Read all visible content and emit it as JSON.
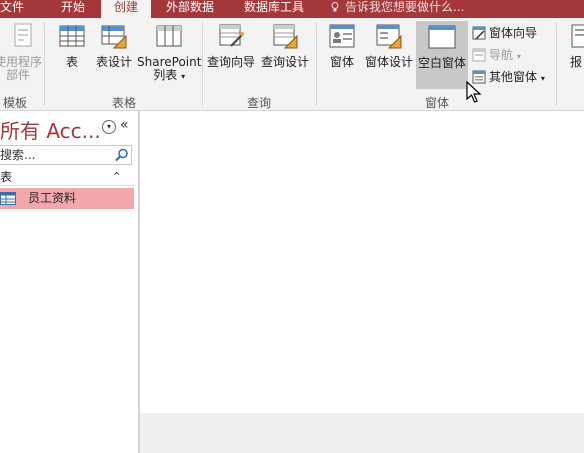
{
  "tabs": {
    "file": "文件",
    "home": "开始",
    "create": "创建",
    "external": "外部数据",
    "dbtools": "数据库工具",
    "tell_me": "告诉我您想要做什么..."
  },
  "ribbon": {
    "templates": {
      "app_parts_line1": "使用程序",
      "app_parts_line2": "部件",
      "label": "模板"
    },
    "tables": {
      "table": "表",
      "table_design": "表设计",
      "sharepoint_line1": "SharePoint",
      "sharepoint_line2": "列表",
      "label": "表格"
    },
    "queries": {
      "query_wizard": "查询向导",
      "query_design": "查询设计",
      "label": "查询"
    },
    "forms": {
      "form": "窗体",
      "form_design": "窗体设计",
      "blank_form": "空白窗体",
      "form_wizard": "窗体向导",
      "navigation": "导航",
      "more_forms": "其他窗体",
      "label": "窗体"
    },
    "reports": {
      "report": "报"
    }
  },
  "nav": {
    "title": "所有 Acc...",
    "search_placeholder": "搜索...",
    "section": "表",
    "items": [
      {
        "label": "员工资料",
        "icon": "table-icon"
      }
    ]
  },
  "colors": {
    "accent": "#a4373a",
    "selected_item": "#f4a7ab",
    "ribbon_bg": "#f3f3f3"
  }
}
